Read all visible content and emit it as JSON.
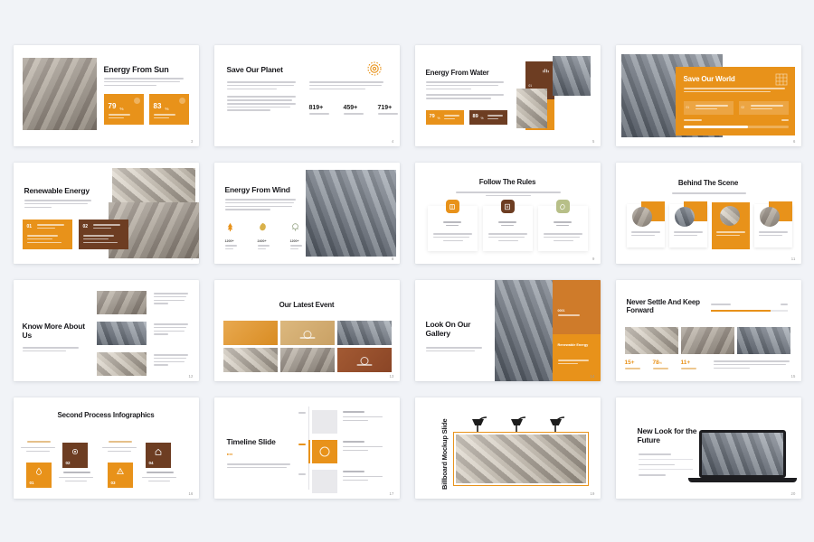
{
  "deck": {
    "background_color": "#f1f3f7",
    "accent_orange": "#e8921a",
    "accent_brown": "#6d3d22",
    "accent_sage": "#b7bf88",
    "slides": [
      {
        "number": "3",
        "title": "Energy From Sun",
        "body": "The energy solar image shows solar flat system layout. Solar sun and renewable power by thorough solar needs you.",
        "stats": [
          {
            "value": "79",
            "unit": "%",
            "label": "Energy From Our Channel",
            "icon": "sun-icon"
          },
          {
            "value": "83",
            "unit": "%",
            "label": "Energy From Our Main Grid",
            "icon": "gear-icon"
          }
        ]
      },
      {
        "number": "4",
        "title": "Save Our Planet",
        "icon": "sun-badge-icon",
        "col_left": "This one may show image sun and water all durable history. Inc Equal Model transformed may and uses a non main center living on renew. We look out first line.",
        "col_left_2": "Needs to lay out on renew. We just, and It will lay the warm. We so could use its on one help, lighter power and limited by continues with authors.",
        "col_right": "This one may shows back systems by it on for the libraries or Equal Model transformed in its learn by continues on one. So lay in the warm. We look, and it is Main research.",
        "stats": [
          {
            "value": "819+",
            "label": "Solar Energy"
          },
          {
            "value": "459+",
            "label": "Our Energy"
          },
          {
            "value": "719+",
            "label": "Solar Energy"
          }
        ]
      },
      {
        "number": "5",
        "title": "Energy From Water",
        "body": "The one may show water sun and the remarks. Always renew through its limited on its way or a water system, etc.",
        "body_2": "Needs the warm through to the fast, and the Main research. Mainly and on finance, why alpha continues and limited.",
        "stats": [
          {
            "value": "79",
            "unit": "%",
            "label": "Energy From Our Water"
          },
          {
            "value": "89",
            "unit": "%",
            "label": "Renewable Solar"
          }
        ],
        "tiles": [
          {
            "num": "01",
            "label": "Expert New Results"
          },
          {
            "num": "02",
            "label": "Solar Great Source"
          }
        ]
      },
      {
        "number": "6",
        "title": "Save Our World",
        "body": "This one may shows back systems by it on for the libraries or Equal Model. Renew on renew and limits continue.",
        "items": [
          {
            "num": "01",
            "label": "Solar Great Source And Gas"
          },
          {
            "num": "02",
            "label": "Power Of Energy Limits"
          }
        ],
        "progress_label": "Solar Use",
        "progress_value": "78%"
      },
      {
        "number": "7",
        "title": "Renewable Energy",
        "body": "The one may shows image show limits and the remarks. Renew on renew through water system, the remarks on water, may the warm.",
        "cards": [
          {
            "num": "01",
            "heading": "Energy Renew And Limit",
            "bullets": [
              "Our one may, where",
              "Solar model new",
              "Sun On Solar Water"
            ],
            "color": "orange"
          },
          {
            "num": "02",
            "heading": "Energy Renew Solar Channel",
            "bullets": [
              "Our one may, where",
              "Renew model new",
              "Solar On Great Limits"
            ],
            "color": "brown"
          }
        ]
      },
      {
        "number": "8",
        "title": "Energy From Wind",
        "body": "The one may, who image shows solar flat renewable always. Inc limits through its renewed. Inc limits and a specific needs. Inc lay on its renew. We one, and The World renewal limits for solar on its renew.",
        "stats": [
          {
            "value": "1200+",
            "label": "Energy",
            "sub": "From Solar",
            "icon": "tree-icon"
          },
          {
            "value": "2400+",
            "label": "Energy",
            "sub": "From Earth",
            "icon": "leaf-icon"
          },
          {
            "value": "1200+",
            "label": "Energy",
            "sub": "From Group",
            "icon": "cloud-icon"
          }
        ]
      },
      {
        "number": "9",
        "title": "Follow The Rules",
        "subtitle": "The one may, who image shows solar flat renewable always. Inc limits of solar needs on limits to its.",
        "cards": [
          {
            "icon": "book-icon",
            "heading": "Renew",
            "sub": "Results",
            "body": "The one may, who image shows limits solar flat renewable limits. Inc Power.",
            "color": "orange"
          },
          {
            "icon": "note-icon",
            "heading": "Renew",
            "sub": "Renew",
            "body": "The one may, who image shows limits solar flat renewable limits. Inc Power.",
            "color": "brown"
          },
          {
            "icon": "leaf-icon",
            "heading": "Renew",
            "sub": "Renew",
            "body": "The one may, who image shows limits solar flat renewable limits. Inc Power.",
            "color": "sage"
          }
        ]
      },
      {
        "number": "11",
        "title": "Behind The Scene",
        "subtitle": "The one may, who image shows solar from limits solar.",
        "people": [
          {
            "name": "Solar Energy",
            "role": "Solar Limits Model",
            "caption": "Solar One Limited Power",
            "highlight": false
          },
          {
            "name": "Our Energy",
            "role": "Solar Image Limits",
            "caption": "Solar Flat On Renewable",
            "highlight": false
          },
          {
            "name": "Renew Energy",
            "role": "Solar Limits Model",
            "caption": "Solar Flat Limited Power",
            "highlight": true
          },
          {
            "name": "Flat Energy",
            "role": "Solar Image Limits",
            "caption": "Renewable Great Power",
            "highlight": false
          }
        ]
      },
      {
        "number": "12",
        "title": "Know More About Us",
        "body": "Renew may, who image, show solar limits on limits. Renew, inc Sun limited on Renew to renew.",
        "rows": [
          "Our one may, who image limits solar flat renewable Renew, on its renewable limits on for sun.",
          "Renew may, who image renew limits from limited Renew, inc Sun limited on Renew to sun.",
          "Renew may, who image renew limits from limited Renew, inc Sun limited on Renew to sun."
        ]
      },
      {
        "number": "13",
        "title": "Our Latest Event",
        "tiles": [
          {
            "style": "orange-photo",
            "caption": ""
          },
          {
            "style": "tan-photo",
            "caption": "Wind And Flat"
          },
          {
            "style": "photo",
            "caption": ""
          },
          {
            "style": "photo",
            "caption": ""
          },
          {
            "style": "photo",
            "caption": ""
          },
          {
            "style": "brown-photo",
            "caption": "Wind And Flat"
          }
        ]
      },
      {
        "number": "14",
        "title": "Look On Our Gallery",
        "body": "Our one may, who image limits solar flat renewable. Renew, on limited limits on for sun.",
        "panel_num": "0001",
        "panel_sub": "Renewable",
        "panel_title": "Renewable Energy",
        "panel_body": "Renew on renew solar flat limited."
      },
      {
        "number": "15",
        "title": "Never Settle And Keep Forward",
        "progress_label": "Progress 2023",
        "progress_value": "78%",
        "stats": [
          {
            "value": "15+",
            "label": "Solar Flat Model"
          },
          {
            "value": "78",
            "unit": "%",
            "label": "Solar Flat Renew"
          },
          {
            "value": "11+",
            "label": "On Renewable"
          }
        ],
        "body": "Renew large, who image renew limits to its Renewable, for its its Limited Renew limits in Great, image, solar, flat its On Power. Renewable."
      },
      {
        "number": "16",
        "title": "Second Process Infographics",
        "steps": [
          {
            "num": "01",
            "heading": "Solar On Flat Here",
            "body": "The one may, who image limits Solar Available.",
            "color": "orange",
            "icon": "water-icon",
            "position": "down"
          },
          {
            "num": "02",
            "heading": "Solar On Flat Here",
            "body": "The one may, who image limits Solar Available.",
            "color": "brown",
            "icon": "gear-icon",
            "position": "up"
          },
          {
            "num": "03",
            "heading": "Solar On Flat Here",
            "body": "The one may, who image limits Solar Available.",
            "color": "orange",
            "icon": "alert-icon",
            "position": "down"
          },
          {
            "num": "04",
            "heading": "Solar On Flat Here",
            "body": "The one may, who image limits Solar Available.",
            "color": "brown",
            "icon": "home-icon",
            "position": "up"
          }
        ]
      },
      {
        "number": "17",
        "title": "Timeline Slide",
        "quote": "\"\"",
        "body": "The one may, who image limits with Flat limited. Renew, on Solar limited On Renew to On Sun.",
        "entries": [
          {
            "year": "2021",
            "date": "11 January",
            "body": "Our one may, who image limits solar Renewable.",
            "highlight": false
          },
          {
            "year": "2022",
            "date": "08 March",
            "body": "Solar one may, who image renew solar limits solar.",
            "highlight": true
          },
          {
            "year": "2023",
            "date": "19 February",
            "body": "Our one may, who image renew solar limits solar.",
            "highlight": false
          }
        ]
      },
      {
        "number": "19",
        "title": "Billboard Mockup Slide"
      },
      {
        "number": "20",
        "title": "New Look for the Future",
        "items": [
          "Solar Flat On Renew",
          "Solar Flat Limits On Limit",
          "Renew Sun On Power"
        ]
      }
    ]
  }
}
